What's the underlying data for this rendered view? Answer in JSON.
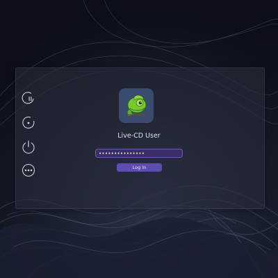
{
  "login_screen": {
    "user_name": "Live-CD User",
    "password_mask": "•••••••••••••••",
    "login_button_label": "Log In"
  },
  "session_actions": [
    {
      "icon": "suspend-icon"
    },
    {
      "icon": "restart-icon"
    },
    {
      "icon": "power-icon"
    },
    {
      "icon": "more-options-icon"
    }
  ],
  "avatar": {
    "icon": "chameleon-mascot-icon",
    "bg_color": "#3a4c6e"
  },
  "colors": {
    "accent": "#5c4db3",
    "field_bg": "#3c2f66",
    "panel_bg": "#282c3a",
    "text": "#dfe3ea",
    "icon": "#d0d4dc"
  }
}
